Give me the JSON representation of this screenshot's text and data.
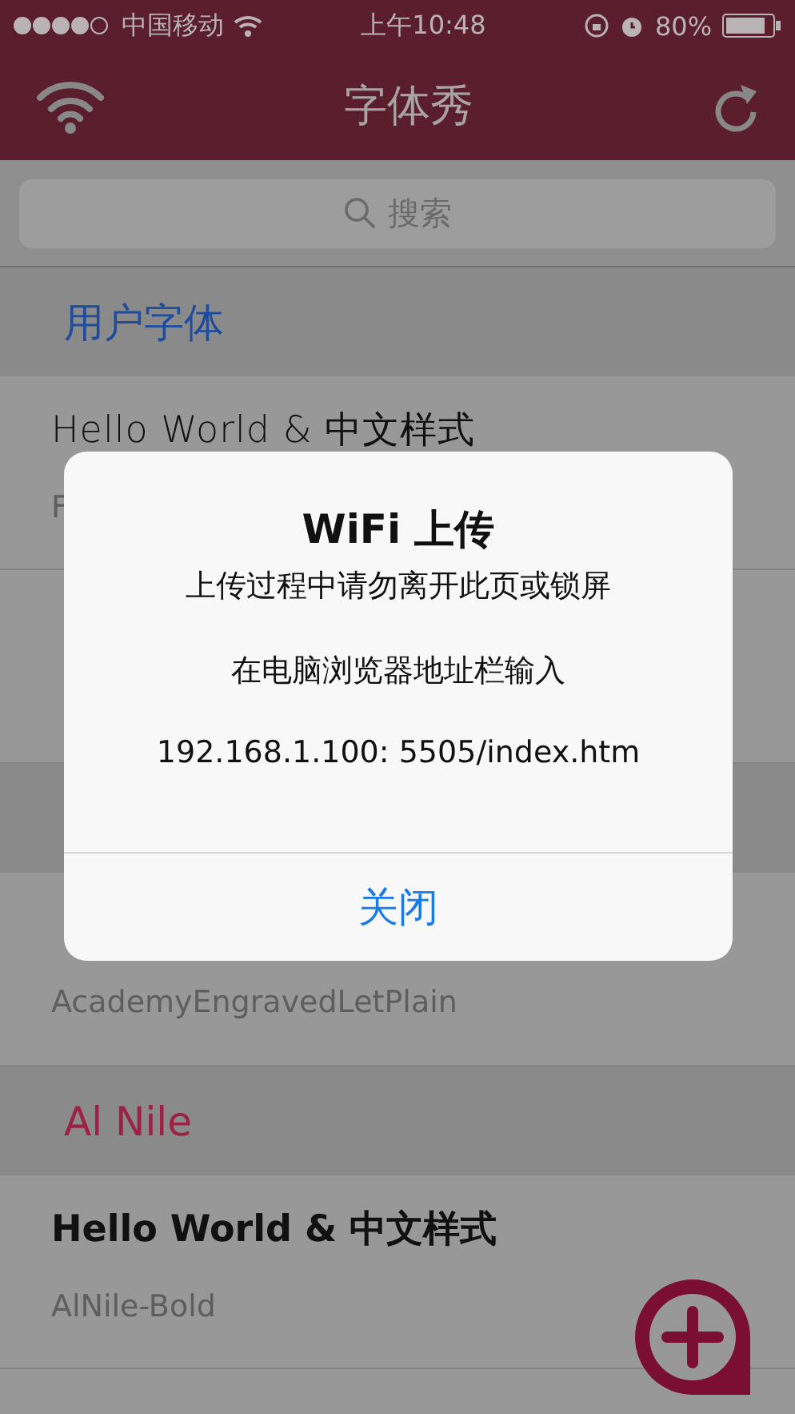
{
  "status_bar": {
    "carrier": "中国移动",
    "time": "上午10:48",
    "battery": "80%"
  },
  "nav": {
    "title": "字体秀"
  },
  "search": {
    "placeholder": "搜索"
  },
  "sections": [
    {
      "title": "用户字体",
      "color": "#1f4c9c",
      "rows": [
        {
          "kind": "thin",
          "sample": "Hello World & 中文样式",
          "name": "F"
        },
        {}
      ]
    },
    {
      "rows": [
        {
          "name": "AcademyEngravedLetPlain"
        }
      ]
    },
    {
      "title": "Al Nile",
      "color": "#9c2244",
      "rows": [
        {
          "kind": "bold",
          "sample": "Hello World & 中文样式",
          "name": "AlNile-Bold"
        }
      ]
    }
  ],
  "dialog": {
    "title": "WiFi 上传",
    "lines": [
      "上传过程中请勿离开此页或锁屏",
      "在电脑浏览器地址栏输入",
      "192.168.1.100: 5505/index.htm"
    ],
    "button": "关闭"
  }
}
